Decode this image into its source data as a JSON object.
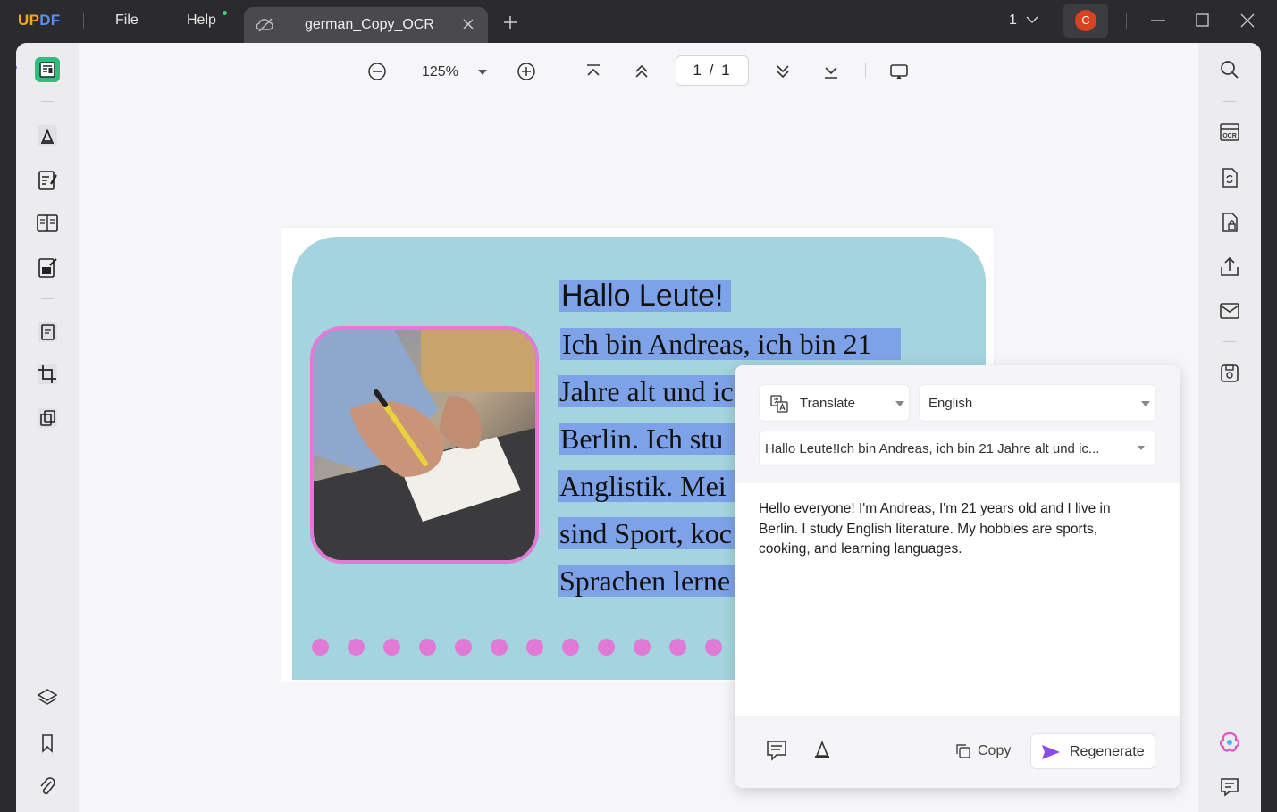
{
  "app": {
    "logo_part1": "UP",
    "logo_part2": "DF"
  },
  "menu": {
    "file": "File",
    "help": "Help"
  },
  "tab": {
    "title": "german_Copy_OCR"
  },
  "titlebar": {
    "page_count": "1",
    "avatar_letter": "C"
  },
  "toolbar": {
    "zoom": "125%",
    "page_current": "1",
    "page_sep": "/",
    "page_total": "1"
  },
  "document": {
    "heading": "Hallo Leute!",
    "lines": [
      "Ich bin Andreas, ich bin 21",
      "Jahre alt und ic",
      "Berlin. Ich stu",
      "Anglistik. Mei",
      "sind Sport, koc",
      "Sprachen lerne"
    ],
    "colors": {
      "card": "#a4d4de",
      "highlight": "#7ea2e8",
      "accent": "#e07ad6"
    }
  },
  "translate_panel": {
    "mode": "Translate",
    "language": "English",
    "source_text": "Hallo Leute!Ich bin Andreas, ich bin 21 Jahre alt und ic...",
    "result": "Hello everyone! I'm Andreas, I'm 21 years old and I live in Berlin. I study English literature. My hobbies are sports, cooking, and learning languages.",
    "copy_label": "Copy",
    "regenerate_label": "Regenerate"
  },
  "icons": {
    "left": [
      "reader-icon",
      "comment-icon",
      "edit-pdf-icon",
      "page-layout-icon",
      "fill-sign-icon",
      "organize-pages-icon",
      "crop-icon",
      "protect-icon",
      "layers-icon",
      "bookmark-icon",
      "attachment-icon"
    ],
    "right": [
      "search-icon",
      "ocr-icon",
      "convert-icon",
      "protect-file-icon",
      "share-icon",
      "email-icon",
      "save-icon",
      "updf-ai-icon",
      "chat-icon"
    ]
  }
}
